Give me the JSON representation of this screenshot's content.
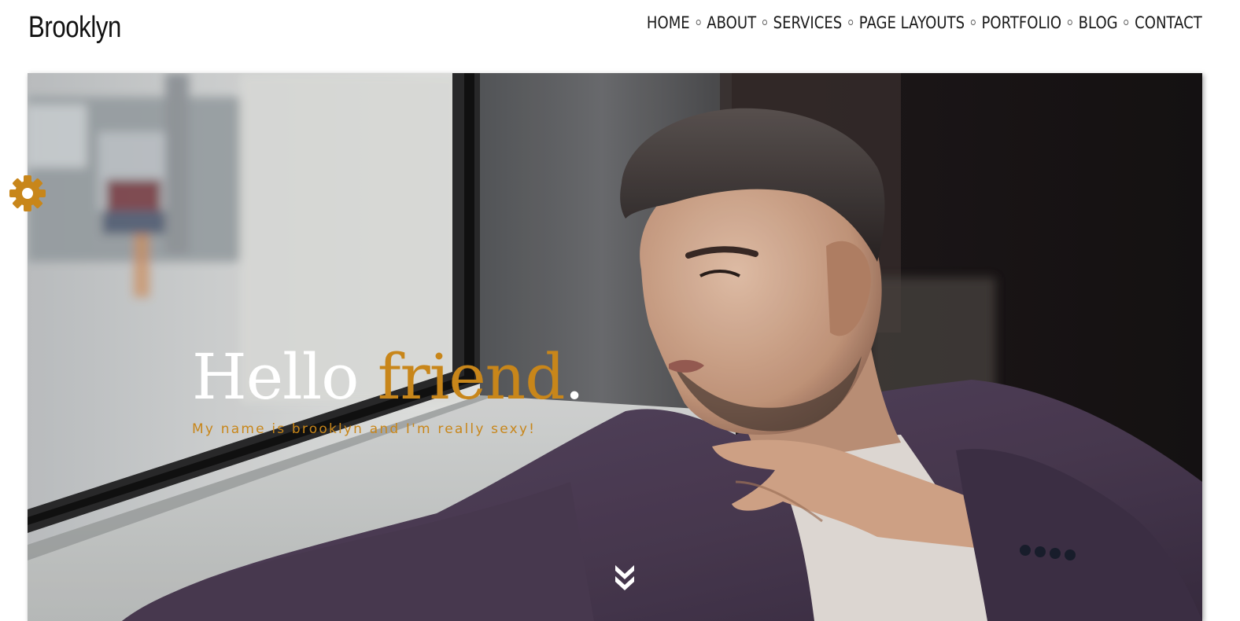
{
  "header": {
    "logo": "Brooklyn",
    "nav": [
      "HOME",
      "ABOUT",
      "SERVICES",
      "PAGE LAYOUTS",
      "PORTFOLIO",
      "BLOG",
      "CONTACT"
    ]
  },
  "hero": {
    "title_word1": "Hello",
    "title_word2": "friend",
    "title_punct": ".",
    "subtitle": "My name is brooklyn and I'm really sexy!"
  },
  "icons": {
    "settings": "gear-icon",
    "scroll": "double-chevron-down-icon"
  },
  "colors": {
    "accent": "#c8861a",
    "text_dark": "#1a1a1a",
    "hero_title": "#ffffff"
  }
}
